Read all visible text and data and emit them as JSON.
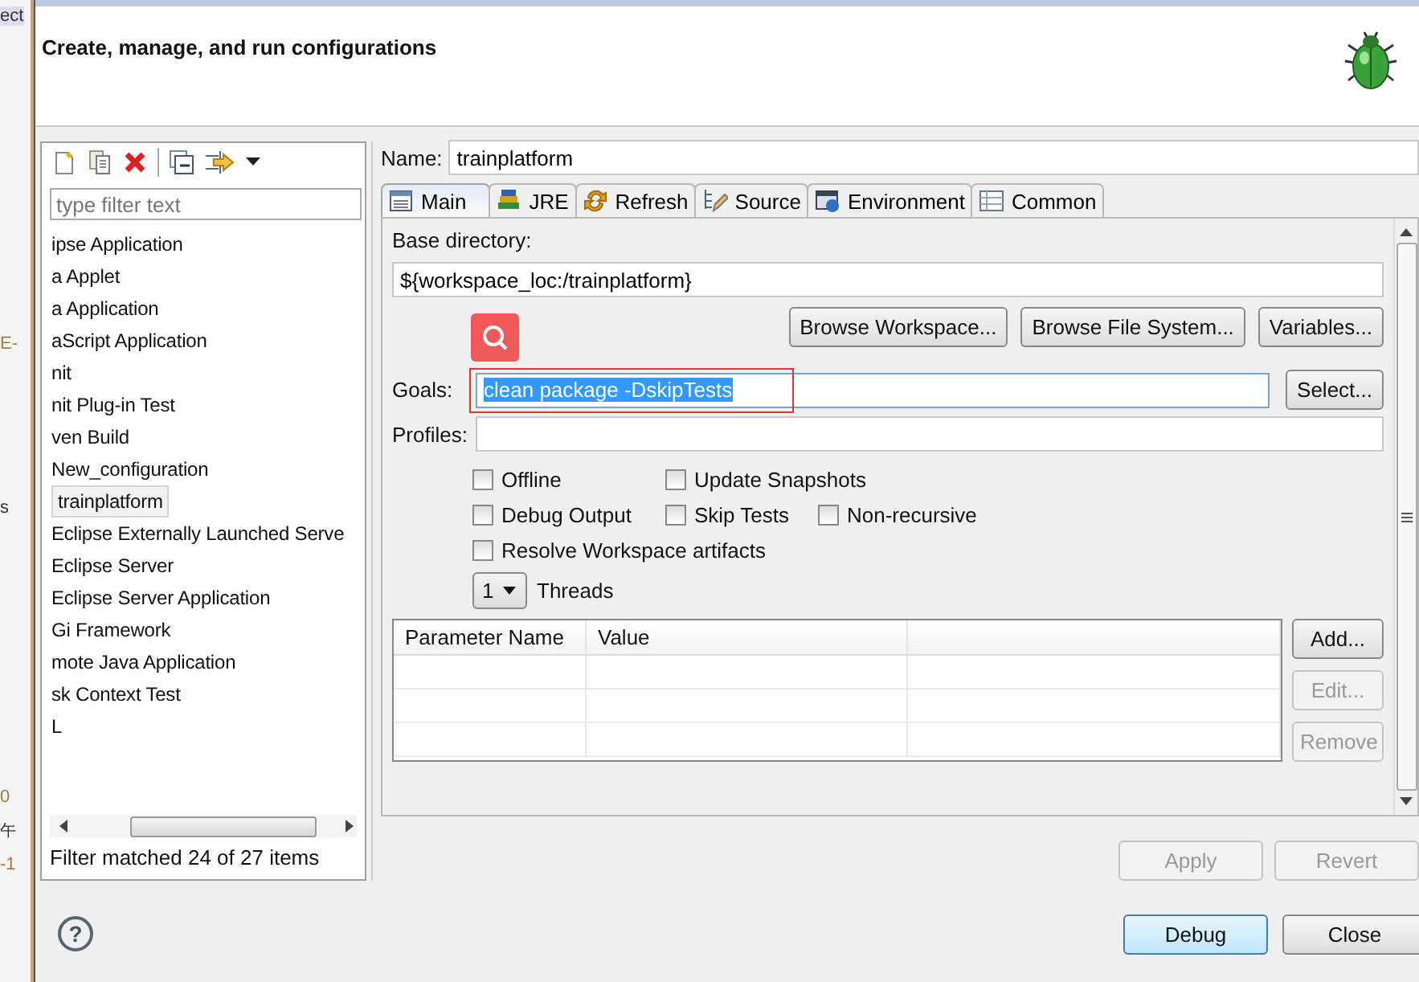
{
  "background_window": {
    "fragments": [
      "ect",
      "E-",
      "s",
      "0",
      "午",
      "-1"
    ]
  },
  "header": {
    "title": "Create, manage, and run configurations"
  },
  "left_panel": {
    "filter": {
      "placeholder": "type filter text"
    },
    "items": [
      {
        "label": "ipse Application",
        "selected": false
      },
      {
        "label": "a Applet",
        "selected": false
      },
      {
        "label": "a Application",
        "selected": false
      },
      {
        "label": "aScript Application",
        "selected": false
      },
      {
        "label": "nit",
        "selected": false
      },
      {
        "label": "nit Plug-in Test",
        "selected": false
      },
      {
        "label": "ven Build",
        "selected": false
      },
      {
        "label": "New_configuration",
        "selected": false
      },
      {
        "label": "trainplatform",
        "selected": true
      },
      {
        "label": "Eclipse Externally Launched Serve",
        "selected": false
      },
      {
        "label": "Eclipse Server",
        "selected": false
      },
      {
        "label": "Eclipse Server Application",
        "selected": false
      },
      {
        "label": "Gi Framework",
        "selected": false
      },
      {
        "label": "mote Java Application",
        "selected": false
      },
      {
        "label": "sk Context Test",
        "selected": false
      },
      {
        "label": "L",
        "selected": false
      }
    ],
    "status": "Filter matched 24 of 27 items"
  },
  "name_field": {
    "label": "Name:",
    "value": "trainplatform"
  },
  "tabs": [
    {
      "label": "Main",
      "selected": true
    },
    {
      "label": "JRE",
      "selected": false
    },
    {
      "label": "Refresh",
      "selected": false
    },
    {
      "label": "Source",
      "selected": false
    },
    {
      "label": "Environment",
      "selected": false
    },
    {
      "label": "Common",
      "selected": false
    }
  ],
  "main_tab": {
    "base_directory_label": "Base directory:",
    "base_directory": "${workspace_loc:/trainplatform}",
    "browse_buttons": [
      "Browse Workspace...",
      "Browse File System...",
      "Variables..."
    ],
    "goals": {
      "label": "Goals:",
      "value": "clean package -DskipTests",
      "button": "Select..."
    },
    "profiles": {
      "label": "Profiles:"
    },
    "options": [
      {
        "label": "Offline",
        "checked": false
      },
      {
        "label": "Update Snapshots",
        "checked": false
      },
      {
        "label": "Debug Output",
        "checked": false
      },
      {
        "label": "Skip Tests",
        "checked": false
      },
      {
        "label": "Non-recursive",
        "checked": false
      },
      {
        "label": "Resolve Workspace artifacts",
        "checked": false
      }
    ],
    "threads": {
      "value": "1",
      "label": "Threads"
    },
    "table": {
      "columns": [
        "Parameter Name",
        "Value"
      ]
    },
    "table_buttons": [
      {
        "label": "Add...",
        "disabled": false
      },
      {
        "label": "Edit...",
        "disabled": true
      },
      {
        "label": "Remove",
        "disabled": true
      }
    ]
  },
  "help": {
    "glyph": "?"
  },
  "actions": [
    {
      "label": "Apply",
      "disabled": true
    },
    {
      "label": "Revert",
      "disabled": true
    }
  ],
  "footer_buttons": [
    {
      "label": "Debug",
      "default": true
    },
    {
      "label": "Close",
      "default": false
    }
  ]
}
